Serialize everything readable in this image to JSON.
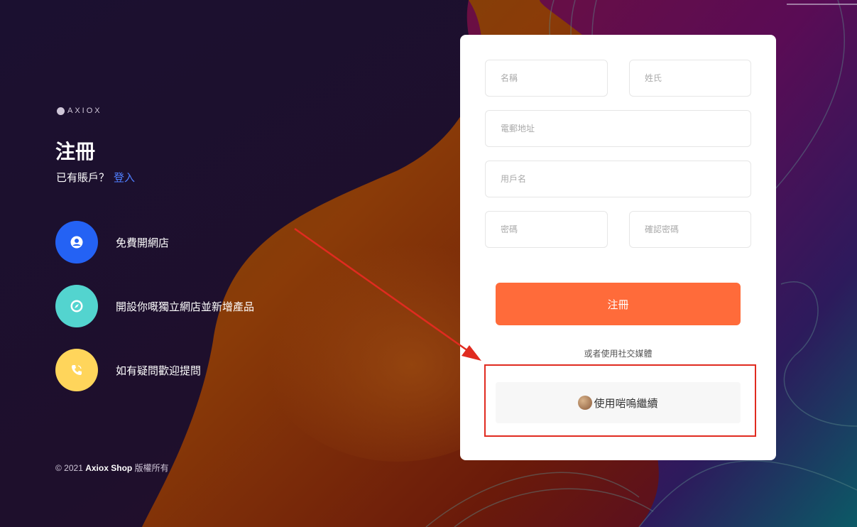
{
  "brand": {
    "logo_text": "AXIOX"
  },
  "page": {
    "title": "注冊",
    "account_prompt": "已有賬戶？",
    "login_link": "登入"
  },
  "features": [
    {
      "label": "免費開網店",
      "icon": "user-circle-icon",
      "color": "#2462f4"
    },
    {
      "label": "開設你嘅獨立網店並新增產品",
      "icon": "compass-icon",
      "color": "#53d4cf"
    },
    {
      "label": "如有疑問歡迎提問",
      "icon": "phone-icon",
      "color": "#ffd55b"
    }
  ],
  "footer": {
    "copyright_prefix": "© 2021",
    "company": "Axiox Shop",
    "rights": "版權所有"
  },
  "form": {
    "first_name_placeholder": "名稱",
    "last_name_placeholder": "姓氏",
    "email_placeholder": "電郵地址",
    "username_placeholder": "用戶名",
    "password_placeholder": "密碼",
    "confirm_password_placeholder": "確認密碼",
    "register_label": "注冊",
    "or_social": "或者使用社交媒體",
    "social_button_label": "使用啱嗚繼續"
  },
  "colors": {
    "accent": "#ff6b3a",
    "link": "#4f7fff",
    "annotation": "#e02b20"
  }
}
